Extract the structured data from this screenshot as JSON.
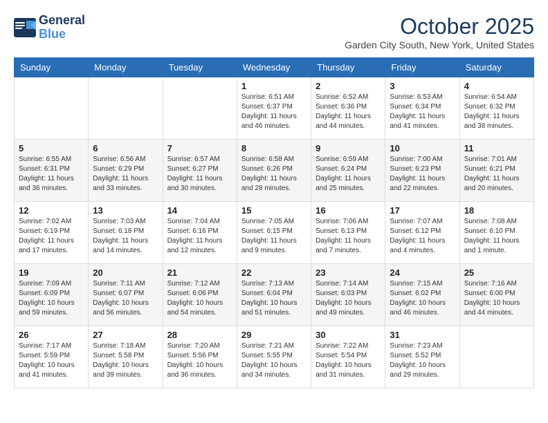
{
  "header": {
    "logo_line1": "General",
    "logo_line2": "Blue",
    "month": "October 2025",
    "location": "Garden City South, New York, United States"
  },
  "weekdays": [
    "Sunday",
    "Monday",
    "Tuesday",
    "Wednesday",
    "Thursday",
    "Friday",
    "Saturday"
  ],
  "weeks": [
    [
      {
        "day": "",
        "info": ""
      },
      {
        "day": "",
        "info": ""
      },
      {
        "day": "",
        "info": ""
      },
      {
        "day": "1",
        "info": "Sunrise: 6:51 AM\nSunset: 6:37 PM\nDaylight: 11 hours and 46 minutes."
      },
      {
        "day": "2",
        "info": "Sunrise: 6:52 AM\nSunset: 6:36 PM\nDaylight: 11 hours and 44 minutes."
      },
      {
        "day": "3",
        "info": "Sunrise: 6:53 AM\nSunset: 6:34 PM\nDaylight: 11 hours and 41 minutes."
      },
      {
        "day": "4",
        "info": "Sunrise: 6:54 AM\nSunset: 6:32 PM\nDaylight: 11 hours and 38 minutes."
      }
    ],
    [
      {
        "day": "5",
        "info": "Sunrise: 6:55 AM\nSunset: 6:31 PM\nDaylight: 11 hours and 36 minutes."
      },
      {
        "day": "6",
        "info": "Sunrise: 6:56 AM\nSunset: 6:29 PM\nDaylight: 11 hours and 33 minutes."
      },
      {
        "day": "7",
        "info": "Sunrise: 6:57 AM\nSunset: 6:27 PM\nDaylight: 11 hours and 30 minutes."
      },
      {
        "day": "8",
        "info": "Sunrise: 6:58 AM\nSunset: 6:26 PM\nDaylight: 11 hours and 28 minutes."
      },
      {
        "day": "9",
        "info": "Sunrise: 6:59 AM\nSunset: 6:24 PM\nDaylight: 11 hours and 25 minutes."
      },
      {
        "day": "10",
        "info": "Sunrise: 7:00 AM\nSunset: 6:23 PM\nDaylight: 11 hours and 22 minutes."
      },
      {
        "day": "11",
        "info": "Sunrise: 7:01 AM\nSunset: 6:21 PM\nDaylight: 11 hours and 20 minutes."
      }
    ],
    [
      {
        "day": "12",
        "info": "Sunrise: 7:02 AM\nSunset: 6:19 PM\nDaylight: 11 hours and 17 minutes."
      },
      {
        "day": "13",
        "info": "Sunrise: 7:03 AM\nSunset: 6:18 PM\nDaylight: 11 hours and 14 minutes."
      },
      {
        "day": "14",
        "info": "Sunrise: 7:04 AM\nSunset: 6:16 PM\nDaylight: 11 hours and 12 minutes."
      },
      {
        "day": "15",
        "info": "Sunrise: 7:05 AM\nSunset: 6:15 PM\nDaylight: 11 hours and 9 minutes."
      },
      {
        "day": "16",
        "info": "Sunrise: 7:06 AM\nSunset: 6:13 PM\nDaylight: 11 hours and 7 minutes."
      },
      {
        "day": "17",
        "info": "Sunrise: 7:07 AM\nSunset: 6:12 PM\nDaylight: 11 hours and 4 minutes."
      },
      {
        "day": "18",
        "info": "Sunrise: 7:08 AM\nSunset: 6:10 PM\nDaylight: 11 hours and 1 minute."
      }
    ],
    [
      {
        "day": "19",
        "info": "Sunrise: 7:09 AM\nSunset: 6:09 PM\nDaylight: 10 hours and 59 minutes."
      },
      {
        "day": "20",
        "info": "Sunrise: 7:11 AM\nSunset: 6:07 PM\nDaylight: 10 hours and 56 minutes."
      },
      {
        "day": "21",
        "info": "Sunrise: 7:12 AM\nSunset: 6:06 PM\nDaylight: 10 hours and 54 minutes."
      },
      {
        "day": "22",
        "info": "Sunrise: 7:13 AM\nSunset: 6:04 PM\nDaylight: 10 hours and 51 minutes."
      },
      {
        "day": "23",
        "info": "Sunrise: 7:14 AM\nSunset: 6:03 PM\nDaylight: 10 hours and 49 minutes."
      },
      {
        "day": "24",
        "info": "Sunrise: 7:15 AM\nSunset: 6:02 PM\nDaylight: 10 hours and 46 minutes."
      },
      {
        "day": "25",
        "info": "Sunrise: 7:16 AM\nSunset: 6:00 PM\nDaylight: 10 hours and 44 minutes."
      }
    ],
    [
      {
        "day": "26",
        "info": "Sunrise: 7:17 AM\nSunset: 5:59 PM\nDaylight: 10 hours and 41 minutes."
      },
      {
        "day": "27",
        "info": "Sunrise: 7:18 AM\nSunset: 5:58 PM\nDaylight: 10 hours and 39 minutes."
      },
      {
        "day": "28",
        "info": "Sunrise: 7:20 AM\nSunset: 5:56 PM\nDaylight: 10 hours and 36 minutes."
      },
      {
        "day": "29",
        "info": "Sunrise: 7:21 AM\nSunset: 5:55 PM\nDaylight: 10 hours and 34 minutes."
      },
      {
        "day": "30",
        "info": "Sunrise: 7:22 AM\nSunset: 5:54 PM\nDaylight: 10 hours and 31 minutes."
      },
      {
        "day": "31",
        "info": "Sunrise: 7:23 AM\nSunset: 5:52 PM\nDaylight: 10 hours and 29 minutes."
      },
      {
        "day": "",
        "info": ""
      }
    ]
  ]
}
